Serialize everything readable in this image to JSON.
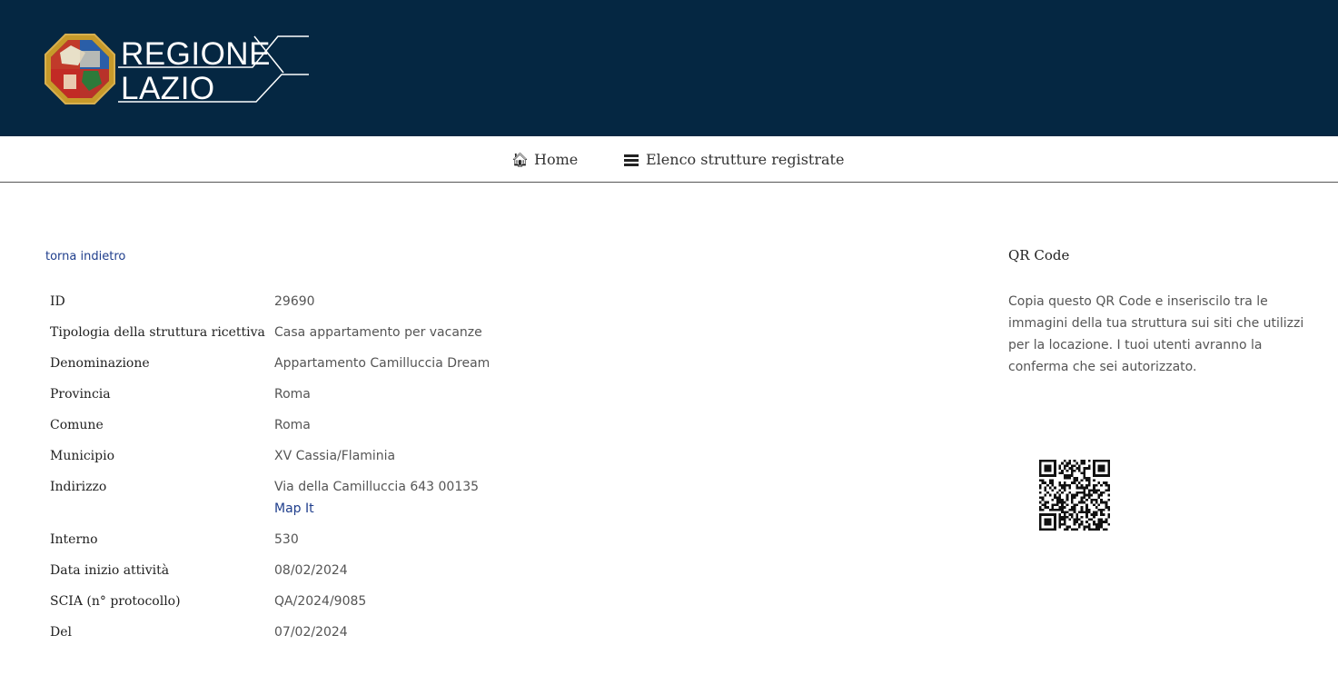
{
  "header": {
    "logo_line1": "REGIONE",
    "logo_line2": "LAZIO"
  },
  "nav": {
    "items": [
      {
        "label": "Home",
        "icon": "home-icon"
      },
      {
        "label": "Elenco strutture registrate",
        "icon": "list-icon"
      }
    ]
  },
  "main": {
    "back_link": "torna indietro",
    "rows": [
      {
        "label": "ID",
        "value": "29690"
      },
      {
        "label": "Tipologia della struttura ricettiva",
        "value": "Casa appartamento per vacanze"
      },
      {
        "label": "Denominazione",
        "value": "Appartamento Camilluccia Dream"
      },
      {
        "label": "Provincia",
        "value": "Roma"
      },
      {
        "label": "Comune",
        "value": "Roma"
      },
      {
        "label": "Municipio",
        "value": "XV Cassia/Flaminia"
      },
      {
        "label": "Indirizzo",
        "value": "Via della Camilluccia 643 00135",
        "link": "Map It"
      },
      {
        "label": "Interno",
        "value": "530"
      },
      {
        "label": "Data inizio attività",
        "value": "08/02/2024"
      },
      {
        "label": "SCIA (n° protocollo)",
        "value": "QA/2024/9085"
      },
      {
        "label": "Del",
        "value": "07/02/2024"
      }
    ]
  },
  "qr": {
    "title": "QR Code",
    "description": "Copia questo QR Code e inseriscilo tra le immagini della tua struttura sui siti che utilizzi per la locazione. I tuoi utenti avranno la conferma che sei autorizzato."
  },
  "colors": {
    "header_bg": "#052742",
    "link": "#1f3e8c"
  }
}
